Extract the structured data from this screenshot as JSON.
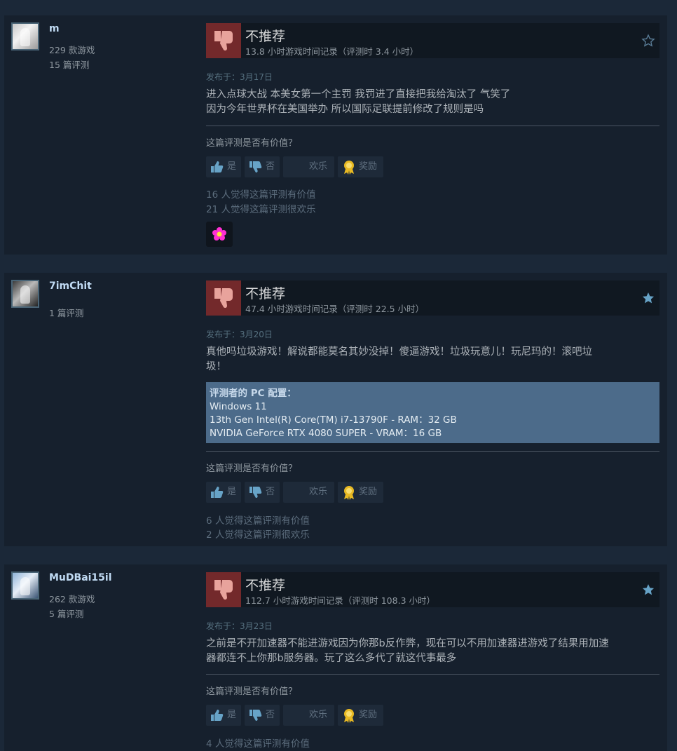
{
  "ui": {
    "not_recommended": "不推荐",
    "posted_prefix": "发布于：",
    "helpful_question": "这篇评测是否有价值？",
    "vote_yes": "是",
    "vote_no": "否",
    "vote_funny": "欢乐",
    "vote_award": "奖励",
    "specs_title": "评测者的 PC 配置："
  },
  "reviews": [
    {
      "author": "m",
      "games_owned": "229 款游戏",
      "review_count": "15 篇评测",
      "hours": "13.8 小时游戏时间记录（评测时 3.4 小时）",
      "date": "3月17日",
      "text": "进入点球大战 本美女第一个主罚 我罚进了直接把我给淘汰了 气笑了\n因为今年世界杯在美国举办 所以国际足联提前修改了规则是吗",
      "helpful_count": "16 人觉得这篇评测有价值",
      "funny_count": "21 人觉得这篇评测很欢乐",
      "star_filled": false,
      "award_icon": "flower-award-icon"
    },
    {
      "author": "7imChit",
      "review_count": "1 篇评测",
      "hours": "47.4 小时游戏时间记录（评测时 22.5 小时）",
      "date": "3月20日",
      "text": "真他吗垃圾游戏！解说都能莫名其妙没掉！傻逼游戏！垃圾玩意儿！玩尼玛的！滚吧垃\n圾！",
      "specs": [
        "Windows 11",
        "13th Gen Intel(R) Core(TM) i7-13790F - RAM：32 GB",
        "NVIDIA GeForce RTX 4080 SUPER - VRAM：16 GB"
      ],
      "helpful_count": "6 人觉得这篇评测有价值",
      "funny_count": "2 人觉得这篇评测很欢乐",
      "star_filled": true
    },
    {
      "author": "MuDBai15il",
      "games_owned": "262 款游戏",
      "review_count": "5 篇评测",
      "hours": "112.7 小时游戏时间记录（评测时 108.3 小时）",
      "date": "3月23日",
      "text": "之前是不开加速器不能进游戏因为你那b反作弊，现在可以不用加速器进游戏了结果用加速\n器都连不上你那b服务器。玩了这么多代了就这代事最多",
      "helpful_count": "4 人觉得这篇评测有价值",
      "star_filled": true
    }
  ],
  "colors": {
    "page_bg": "#1b2838",
    "card_bg": "#16202d",
    "thumb_down_bg": "#73292b",
    "specs_bg": "#4c6b8a",
    "star": "#67a3c7"
  }
}
